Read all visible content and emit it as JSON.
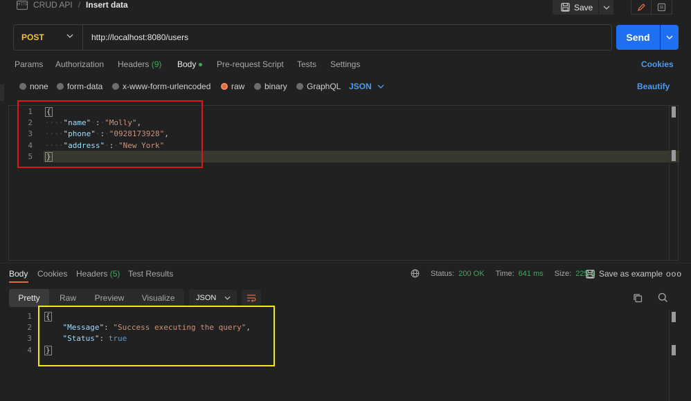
{
  "breadcrumb": {
    "icon": "http-file-icon",
    "icon_text": "HTTP",
    "parent": "CRUD API",
    "separator": "/",
    "current": "Insert data"
  },
  "toolbar": {
    "save_label": "Save"
  },
  "request": {
    "method": "POST",
    "url": "http://localhost:8080/users",
    "send_label": "Send"
  },
  "request_tabs": [
    {
      "label": "Params"
    },
    {
      "label": "Authorization"
    },
    {
      "label": "Headers",
      "count": "(9)"
    },
    {
      "label": "Body",
      "active": true
    },
    {
      "label": "Pre-request Script"
    },
    {
      "label": "Tests"
    },
    {
      "label": "Settings"
    }
  ],
  "cookies_label": "Cookies",
  "body_types": [
    "none",
    "form-data",
    "x-www-form-urlencoded",
    "raw",
    "binary",
    "GraphQL"
  ],
  "body_selected": "raw",
  "body_format": "JSON",
  "beautify_label": "Beautify",
  "request_body": {
    "line_numbers": [
      "1",
      "2",
      "3",
      "4",
      "5"
    ],
    "open": "{",
    "close": "}",
    "fields": [
      {
        "key": "\"name\"",
        "value": "\"Molly\"",
        "comma": ","
      },
      {
        "key": "\"phone\"",
        "value": "\"0928173928\"",
        "comma": ","
      },
      {
        "key": "\"address\"",
        "value": "\"New York\"",
        "comma": ""
      }
    ]
  },
  "response_tabs": [
    {
      "label": "Body",
      "active": true
    },
    {
      "label": "Cookies"
    },
    {
      "label": "Headers",
      "count": "(5)"
    },
    {
      "label": "Test Results"
    }
  ],
  "response_status": {
    "status_label": "Status:",
    "status_value": "200 OK",
    "time_label": "Time:",
    "time_value": "641 ms",
    "size_label": "Size:",
    "size_value": "225 B"
  },
  "save_example_label": "Save as example",
  "more_label": "ooo",
  "response_views": [
    "Pretty",
    "Raw",
    "Preview",
    "Visualize"
  ],
  "response_format": "JSON",
  "response_body": {
    "line_numbers": [
      "1",
      "2",
      "3",
      "4"
    ],
    "open": "{",
    "close": "}",
    "message_key": "\"Message\"",
    "message_value": "\"Success executing the query\"",
    "status_key": "\"Status\"",
    "status_value": "true"
  },
  "colors": {
    "accent_blue": "#1f6ff0",
    "method_post": "#f0c14b",
    "status_green": "#3ea85a",
    "annotation_red": "#e3131b",
    "annotation_yellow": "#f5e81a"
  }
}
